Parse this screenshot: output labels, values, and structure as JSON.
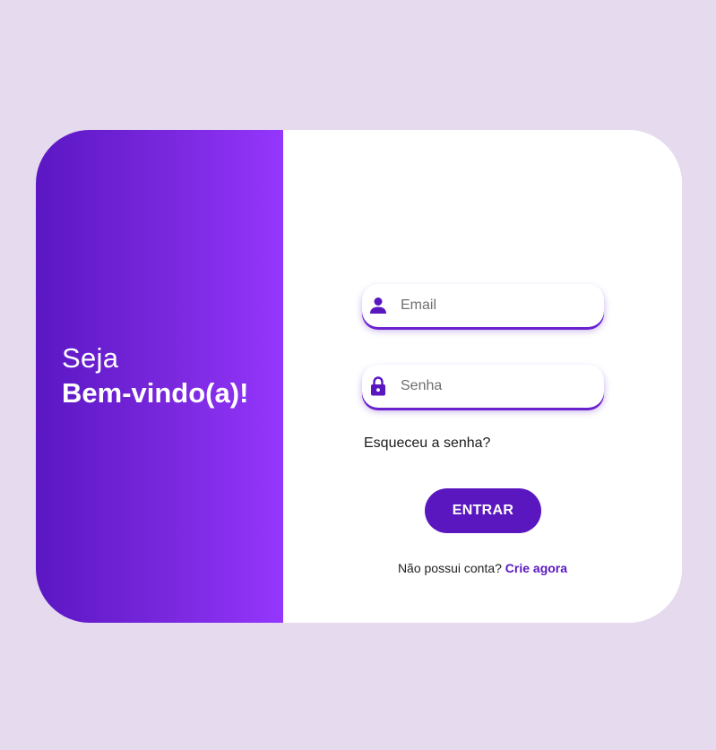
{
  "welcome": {
    "line1": "Seja",
    "line2": "Bem-vindo(a)!"
  },
  "form": {
    "email": {
      "placeholder": "Email",
      "value": "",
      "icon": "user-icon"
    },
    "password": {
      "placeholder": "Senha",
      "value": "",
      "icon": "lock-icon"
    },
    "forgot_label": "Esqueceu a senha?",
    "submit_label": "ENTRAR",
    "signup_prompt": "Não possui conta?",
    "signup_link": "Crie agora"
  },
  "colors": {
    "page_background": "#e5daee",
    "accent": "#5a17bf",
    "gradient_start": "#5b17c3",
    "gradient_end": "#9536fd",
    "card_background": "#ffffff"
  }
}
